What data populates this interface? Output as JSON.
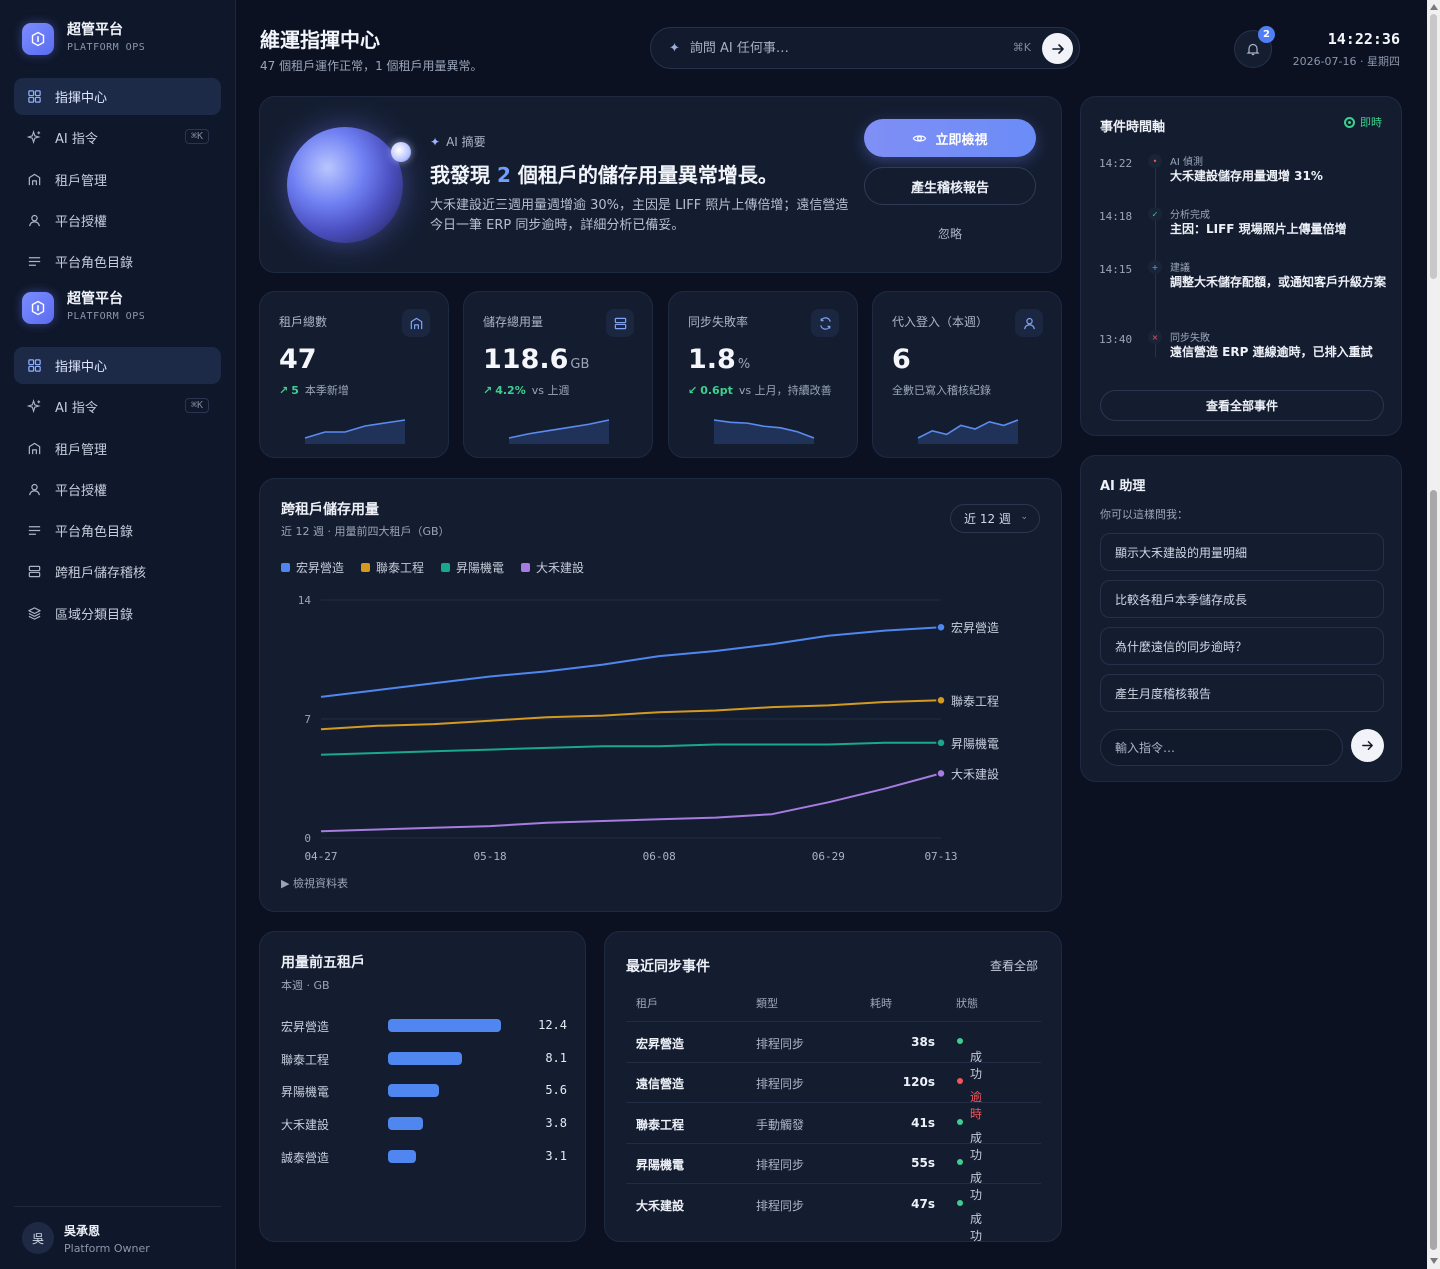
{
  "brand": {
    "title": "超管平台",
    "subtitle": "PLATFORM OPS"
  },
  "nav_groups": [
    {
      "items": [
        {
          "label": "指揮中心",
          "icon": "grid-icon",
          "active": true
        },
        {
          "label": "AI 指令",
          "icon": "sparkle-icon",
          "shortcut": "⌘K"
        },
        {
          "label": "租戶管理",
          "icon": "building-icon"
        },
        {
          "label": "平台授權",
          "icon": "user-icon"
        },
        {
          "label": "平台角色目錄",
          "icon": "list-icon"
        }
      ]
    },
    {
      "items": [
        {
          "label": "指揮中心",
          "icon": "grid-icon",
          "active": true
        },
        {
          "label": "AI 指令",
          "icon": "sparkle-icon",
          "shortcut": "⌘K"
        },
        {
          "label": "租戶管理",
          "icon": "building-icon"
        },
        {
          "label": "平台授權",
          "icon": "user-icon"
        },
        {
          "label": "平台角色目錄",
          "icon": "list-icon"
        },
        {
          "label": "跨租戶儲存稽核",
          "icon": "storage-icon"
        },
        {
          "label": "區域分類目錄",
          "icon": "layers-icon"
        }
      ]
    }
  ],
  "user": {
    "avatar": "吳",
    "name": "吳承恩",
    "role": "Platform Owner"
  },
  "header": {
    "title": "維運指揮中心",
    "subtitle": "47 個租戶運作正常，1 個租戶用量異常。",
    "search_placeholder": "詢問 AI 任何事…",
    "search_shortcut": "⌘K",
    "notification_count": "2",
    "time": "14:22:36",
    "date": "2026-07-16 · 星期四"
  },
  "hero": {
    "tag": "AI 摘要",
    "headline_pre": "我發現 ",
    "headline_num": "2",
    "headline_post": " 個租戶的儲存用量異常增長。",
    "body": "大禾建設近三週用量週增逾 30%，主因是 LIFF 照片上傳倍增；遠信營造今日一筆 ERP 同步逾時，詳細分析已備妥。",
    "primary_label": "立即檢視",
    "secondary_label": "產生稽核報告",
    "ghost_label": "忽略"
  },
  "stats": [
    {
      "label": "租戶總數",
      "value": "47",
      "unit": "",
      "delta": "5",
      "delta_arrow": "↗",
      "delta_text": "本季新增",
      "delta_color": "#3ecf8e",
      "icon": "building-icon",
      "spark": [
        3,
        4,
        4,
        5,
        5.5,
        6
      ]
    },
    {
      "label": "儲存總用量",
      "value": "118.6",
      "unit": "GB",
      "delta": "4.2%",
      "delta_arrow": "↗",
      "delta_text": "vs 上週",
      "delta_color": "#3ecf8e",
      "icon": "storage-icon",
      "spark": [
        3,
        3.8,
        4.4,
        5,
        5.6,
        6.4
      ]
    },
    {
      "label": "同步失敗率",
      "value": "1.8",
      "unit": "%",
      "delta": "0.6pt",
      "delta_arrow": "↙",
      "delta_text": "vs 上月，持續改善",
      "delta_color": "#3ecf8e",
      "icon": "refresh-icon",
      "spark": [
        7,
        6.4,
        6.2,
        5.4,
        5,
        4,
        2.4
      ]
    },
    {
      "label": "代入登入（本週）",
      "value": "6",
      "unit": "",
      "delta": "",
      "delta_arrow": "",
      "delta_text": "全數已寫入稽核紀錄",
      "delta_color": "#3ecf8e",
      "icon": "user-icon",
      "spark": [
        1,
        3,
        2,
        4.5,
        3.5,
        5.5,
        4.5,
        6
      ]
    }
  ],
  "chart_panel": {
    "title": "跨租戶儲存用量",
    "subtitle": "近 12 週 · 用量前四大租戶（GB）",
    "range_label": "近 12 週",
    "view_table": "▶ 檢視資料表"
  },
  "chart_data": {
    "type": "line",
    "x": [
      "04-27",
      "05-04",
      "05-11",
      "05-18",
      "05-25",
      "06-01",
      "06-08",
      "06-15",
      "06-22",
      "06-29",
      "07-06",
      "07-13"
    ],
    "x_ticks": [
      "04-27",
      "05-18",
      "06-08",
      "06-29",
      "07-13"
    ],
    "y_ticks": [
      0,
      7,
      14
    ],
    "ylim": [
      0,
      14
    ],
    "grid": true,
    "legend": "top-left",
    "series": [
      {
        "name": "宏昇營造",
        "color": "#4f86f0",
        "values": [
          8.3,
          8.7,
          9.1,
          9.5,
          9.8,
          10.2,
          10.7,
          11.0,
          11.4,
          11.9,
          12.2,
          12.4
        ]
      },
      {
        "name": "聯泰工程",
        "color": "#d49a1f",
        "values": [
          6.4,
          6.6,
          6.7,
          6.9,
          7.1,
          7.2,
          7.4,
          7.5,
          7.7,
          7.8,
          8.0,
          8.1
        ]
      },
      {
        "name": "昇陽機電",
        "color": "#19a88e",
        "values": [
          4.9,
          5.0,
          5.1,
          5.2,
          5.3,
          5.4,
          5.4,
          5.5,
          5.5,
          5.5,
          5.6,
          5.6
        ]
      },
      {
        "name": "大禾建設",
        "color": "#a77ce0",
        "values": [
          0.4,
          0.5,
          0.6,
          0.7,
          0.9,
          1.0,
          1.1,
          1.2,
          1.4,
          2.1,
          2.9,
          3.8
        ]
      }
    ]
  },
  "top5": {
    "title": "用量前五租戶",
    "subtitle": "本週 · GB",
    "max": 12.4,
    "rows": [
      {
        "name": "宏昇營造",
        "value": 12.4,
        "label": "12.4"
      },
      {
        "name": "聯泰工程",
        "value": 8.1,
        "label": "8.1"
      },
      {
        "name": "昇陽機電",
        "value": 5.6,
        "label": "5.6"
      },
      {
        "name": "大禾建設",
        "value": 3.8,
        "label": "3.8"
      },
      {
        "name": "誠泰營造",
        "value": 3.1,
        "label": "3.1"
      }
    ]
  },
  "sync": {
    "title": "最近同步事件",
    "view_all": "查看全部",
    "headers": [
      "租戶",
      "類型",
      "耗時",
      "狀態"
    ],
    "rows": [
      {
        "tenant": "宏昇營造",
        "type": "排程同步",
        "duration": "38s",
        "status": "成功",
        "color": "#3ecf8e"
      },
      {
        "tenant": "遠信營造",
        "type": "排程同步",
        "duration": "120s",
        "status": "逾時",
        "color": "#f2555a"
      },
      {
        "tenant": "聯泰工程",
        "type": "手動觸發",
        "duration": "41s",
        "status": "成功",
        "color": "#3ecf8e"
      },
      {
        "tenant": "昇陽機電",
        "type": "排程同步",
        "duration": "55s",
        "status": "成功",
        "color": "#3ecf8e"
      },
      {
        "tenant": "大禾建設",
        "type": "排程同步",
        "duration": "47s",
        "status": "成功",
        "color": "#3ecf8e"
      }
    ]
  },
  "timeline": {
    "title": "事件時間軸",
    "live": "即時",
    "items": [
      {
        "time": "14:22",
        "kind": "AI 偵測",
        "text": "大禾建設儲存用量週增 31%",
        "mark": "•",
        "color": "#f2555a"
      },
      {
        "time": "14:18",
        "kind": "分析完成",
        "text": "主因：LIFF 現場照片上傳量倍增",
        "mark": "✓",
        "color": "#3ecf8e"
      },
      {
        "time": "14:15",
        "kind": "建議",
        "text": "調整大禾儲存配額，或通知客戶升級方案",
        "mark": "+",
        "color": "#6ea0ff"
      },
      {
        "time": "13:40",
        "kind": "同步失敗",
        "text": "遠信營造 ERP 連線逾時，已排入重試",
        "mark": "×",
        "color": "#f2555a"
      }
    ],
    "button": "查看全部事件"
  },
  "assistant": {
    "title": "AI 助理",
    "subtitle": "你可以這樣問我：",
    "suggestions": [
      "顯示大禾建設的用量明細",
      "比較各租戶本季儲存成長",
      "為什麼遠信的同步逾時？",
      "產生月度稽核報告"
    ],
    "input_placeholder": "輸入指令…"
  }
}
